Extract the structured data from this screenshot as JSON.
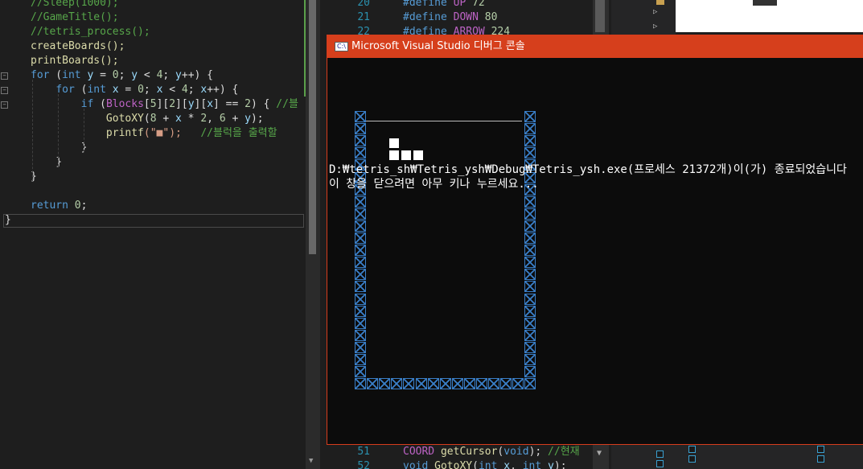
{
  "left_editor": {
    "lines": [
      {
        "parts": [
          {
            "t": "//Sleep(1000);",
            "c": "comment"
          }
        ]
      },
      {
        "parts": [
          {
            "t": "//GameTitle();",
            "c": "comment"
          }
        ]
      },
      {
        "parts": [
          {
            "t": "//tetris_process();",
            "c": "comment"
          }
        ]
      },
      {
        "parts": [
          {
            "t": "createBoards();",
            "c": "fn"
          }
        ]
      },
      {
        "parts": [
          {
            "t": "printBoards();",
            "c": "fn"
          }
        ]
      },
      {
        "parts": [
          {
            "t": "for",
            "c": "kw"
          },
          {
            "t": " (",
            "c": "p"
          },
          {
            "t": "int",
            "c": "kw"
          },
          {
            "t": " ",
            "c": "p"
          },
          {
            "t": "y",
            "c": "var"
          },
          {
            "t": " = ",
            "c": "p"
          },
          {
            "t": "0",
            "c": "num"
          },
          {
            "t": "; ",
            "c": "p"
          },
          {
            "t": "y",
            "c": "var"
          },
          {
            "t": " < ",
            "c": "p"
          },
          {
            "t": "4",
            "c": "num"
          },
          {
            "t": "; ",
            "c": "p"
          },
          {
            "t": "y",
            "c": "var"
          },
          {
            "t": "++) {",
            "c": "p"
          }
        ]
      },
      {
        "parts": [
          {
            "t": "    ",
            "c": "p"
          },
          {
            "t": "for",
            "c": "kw"
          },
          {
            "t": " (",
            "c": "p"
          },
          {
            "t": "int",
            "c": "kw"
          },
          {
            "t": " ",
            "c": "p"
          },
          {
            "t": "x",
            "c": "var"
          },
          {
            "t": " = ",
            "c": "p"
          },
          {
            "t": "0",
            "c": "num"
          },
          {
            "t": "; ",
            "c": "p"
          },
          {
            "t": "x",
            "c": "var"
          },
          {
            "t": " < ",
            "c": "p"
          },
          {
            "t": "4",
            "c": "num"
          },
          {
            "t": "; ",
            "c": "p"
          },
          {
            "t": "x",
            "c": "var"
          },
          {
            "t": "++) {",
            "c": "p"
          }
        ]
      },
      {
        "parts": [
          {
            "t": "        ",
            "c": "p"
          },
          {
            "t": "if",
            "c": "kw"
          },
          {
            "t": " (",
            "c": "p"
          },
          {
            "t": "Blocks",
            "c": "macro"
          },
          {
            "t": "[",
            "c": "p"
          },
          {
            "t": "5",
            "c": "num"
          },
          {
            "t": "][",
            "c": "p"
          },
          {
            "t": "2",
            "c": "num"
          },
          {
            "t": "][",
            "c": "p"
          },
          {
            "t": "y",
            "c": "var"
          },
          {
            "t": "][",
            "c": "p"
          },
          {
            "t": "x",
            "c": "var"
          },
          {
            "t": "] == ",
            "c": "p"
          },
          {
            "t": "2",
            "c": "num"
          },
          {
            "t": ") { ",
            "c": "p"
          },
          {
            "t": "//블",
            "c": "comment"
          }
        ]
      },
      {
        "parts": [
          {
            "t": "            ",
            "c": "p"
          },
          {
            "t": "GotoXY",
            "c": "fn"
          },
          {
            "t": "(",
            "c": "p"
          },
          {
            "t": "8",
            "c": "num"
          },
          {
            "t": " + ",
            "c": "p"
          },
          {
            "t": "x",
            "c": "var"
          },
          {
            "t": " * ",
            "c": "p"
          },
          {
            "t": "2",
            "c": "num"
          },
          {
            "t": ", ",
            "c": "p"
          },
          {
            "t": "6",
            "c": "num"
          },
          {
            "t": " + ",
            "c": "p"
          },
          {
            "t": "y",
            "c": "var"
          },
          {
            "t": ");",
            "c": "p"
          }
        ]
      },
      {
        "parts": [
          {
            "t": "            ",
            "c": "p"
          },
          {
            "t": "printf",
            "c": "fn"
          },
          {
            "t": "(\"■\");   ",
            "c": "str"
          },
          {
            "t": "//블럭을 출력할",
            "c": "comment"
          }
        ]
      },
      {
        "parts": [
          {
            "t": "        }",
            "c": "p"
          }
        ]
      },
      {
        "parts": [
          {
            "t": "    }",
            "c": "p"
          }
        ]
      },
      {
        "parts": [
          {
            "t": "}",
            "c": "p"
          }
        ]
      },
      {
        "parts": [
          {
            "t": "",
            "c": "p"
          }
        ]
      },
      {
        "parts": [
          {
            "t": "return",
            "c": "kw"
          },
          {
            "t": " ",
            "c": "p"
          },
          {
            "t": "0",
            "c": "num"
          },
          {
            "t": ";",
            "c": "p"
          }
        ]
      }
    ],
    "closing_brace": "}"
  },
  "right_editor": {
    "top_lines": [
      {
        "num": "20",
        "parts": [
          {
            "t": "#define ",
            "c": "kw"
          },
          {
            "t": "UP",
            "c": "macro"
          },
          {
            "t": " ",
            "c": "p"
          },
          {
            "t": "72",
            "c": "num"
          }
        ]
      },
      {
        "num": "21",
        "parts": [
          {
            "t": "#define ",
            "c": "kw"
          },
          {
            "t": "DOWN",
            "c": "macro"
          },
          {
            "t": " ",
            "c": "p"
          },
          {
            "t": "80",
            "c": "num"
          }
        ]
      },
      {
        "num": "22",
        "parts": [
          {
            "t": "#define ",
            "c": "kw"
          },
          {
            "t": "ARROW",
            "c": "macro"
          },
          {
            "t": " ",
            "c": "p"
          },
          {
            "t": "224",
            "c": "num"
          }
        ]
      }
    ],
    "bottom_lines": [
      {
        "num": "51",
        "parts": [
          {
            "t": "COORD",
            "c": "macro"
          },
          {
            "t": " ",
            "c": "p"
          },
          {
            "t": "getCursor",
            "c": "fn"
          },
          {
            "t": "(",
            "c": "p"
          },
          {
            "t": "void",
            "c": "kw"
          },
          {
            "t": "); ",
            "c": "p"
          },
          {
            "t": "//현재",
            "c": "comment"
          }
        ]
      },
      {
        "num": "52",
        "parts": [
          {
            "t": "void",
            "c": "kw"
          },
          {
            "t": " ",
            "c": "p"
          },
          {
            "t": "GotoXY",
            "c": "fn"
          },
          {
            "t": "(",
            "c": "p"
          },
          {
            "t": "int",
            "c": "kw"
          },
          {
            "t": " ",
            "c": "p"
          },
          {
            "t": "x",
            "c": "var"
          },
          {
            "t": ", ",
            "c": "p"
          },
          {
            "t": "int",
            "c": "kw"
          },
          {
            "t": " ",
            "c": "p"
          },
          {
            "t": "y",
            "c": "var"
          },
          {
            "t": ");",
            "c": "p"
          }
        ]
      }
    ]
  },
  "console": {
    "icon_label": "C:\\",
    "title": "Microsoft Visual Studio 디버그 콘솔",
    "output_line_1": "D:₩tetris_sh₩Tetris_ysh₩Debug₩Tetris_ysh.exe(프로세스 21372개)이(가) 종료되었습니다",
    "output_line_2": "이 창을 닫으려면 아무 키나 누르세요...",
    "block_cells": [
      [
        2,
        0
      ],
      [
        2,
        1
      ],
      [
        3,
        1
      ],
      [
        4,
        1
      ]
    ]
  },
  "colors": {
    "titlebar": "#d63f1c",
    "wall": "#3a7fc8",
    "comment": "#57a64a",
    "keyword": "#569cd6"
  },
  "icons": [
    "console-app-icon",
    "fold-icon",
    "expand-triangle-icon",
    "scroll-down-arrow-icon"
  ]
}
